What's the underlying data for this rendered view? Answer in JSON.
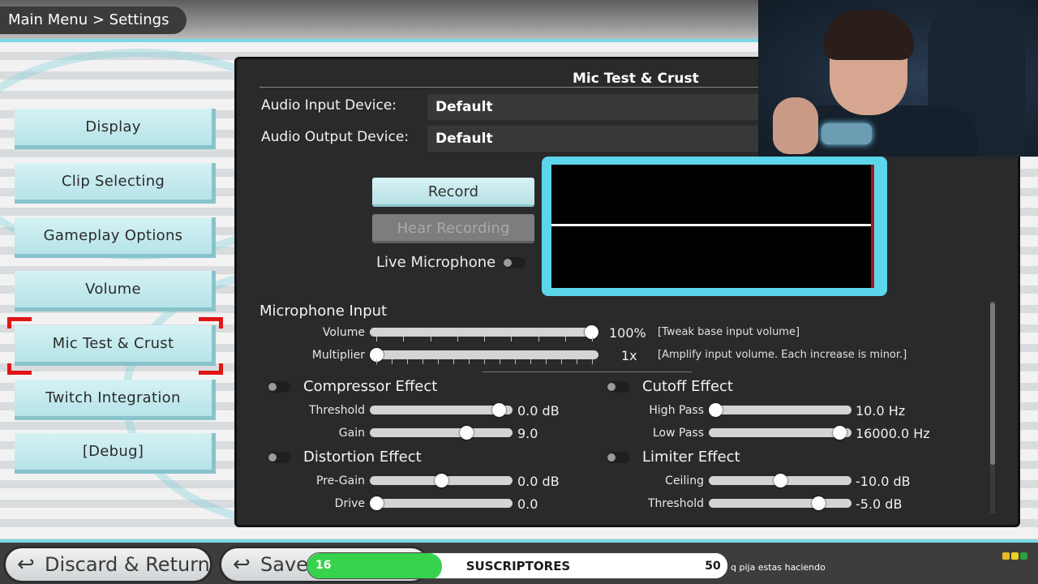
{
  "breadcrumb": "Main Menu > Settings",
  "menu": {
    "items": [
      {
        "label": "Display"
      },
      {
        "label": "Clip Selecting"
      },
      {
        "label": "Gameplay Options"
      },
      {
        "label": "Volume"
      },
      {
        "label": "Mic Test & Crust",
        "selected": true
      },
      {
        "label": "Twitch Integration"
      },
      {
        "label": "[Debug]"
      }
    ]
  },
  "panel": {
    "title": "Mic Test & Crust",
    "audio_input_label": "Audio Input Device:",
    "audio_input_value": "Default",
    "audio_output_label": "Audio Output Device:",
    "audio_output_value": "Default",
    "record_label": "Record",
    "hear_label": "Hear Recording",
    "live_mic_label": "Live Microphone",
    "live_mic_on": false
  },
  "mic_input": {
    "heading": "Microphone Input",
    "volume": {
      "label": "Volume",
      "value_text": "100%",
      "hint": "[Tweak base input volume]",
      "level": 1.0
    },
    "multiplier": {
      "label": "Multiplier",
      "value_text": "1x",
      "hint": "[Amplify input volume. Each increase is minor.]",
      "level": 0.0
    }
  },
  "compressor": {
    "heading": "Compressor Effect",
    "enabled": false,
    "threshold": {
      "label": "Threshold",
      "value_text": "0.0 dB",
      "level": 0.95
    },
    "gain": {
      "label": "Gain",
      "value_text": "9.0",
      "level": 0.7
    }
  },
  "cutoff": {
    "heading": "Cutoff Effect",
    "enabled": false,
    "high_pass": {
      "label": "High Pass",
      "value_text": "10.0 Hz",
      "level": 0.0
    },
    "low_pass": {
      "label": "Low Pass",
      "value_text": "16000.0 Hz",
      "level": 0.96
    }
  },
  "distortion": {
    "heading": "Distortion Effect",
    "enabled": false,
    "pre_gain": {
      "label": "Pre-Gain",
      "value_text": "0.0 dB",
      "level": 0.5
    },
    "drive": {
      "label": "Drive",
      "value_text": "0.0",
      "level": 0.0
    }
  },
  "limiter": {
    "heading": "Limiter Effect",
    "enabled": false,
    "ceiling": {
      "label": "Ceiling",
      "value_text": "-10.0 dB",
      "level": 0.5
    },
    "threshold": {
      "label": "Threshold",
      "value_text": "-5.0 dB",
      "level": 0.8
    }
  },
  "bottom": {
    "discard_label": "Discard & Return",
    "save_label": "Save"
  },
  "subscribers": {
    "from": "16",
    "label": "SUSCRIPTORES",
    "to": "50",
    "progress": 0.32
  },
  "chat": {
    "message": "q pija estas haciendo"
  },
  "colors": {
    "accent": "#79d8e4",
    "selection": "#e01515",
    "progress": "#37d34d"
  }
}
